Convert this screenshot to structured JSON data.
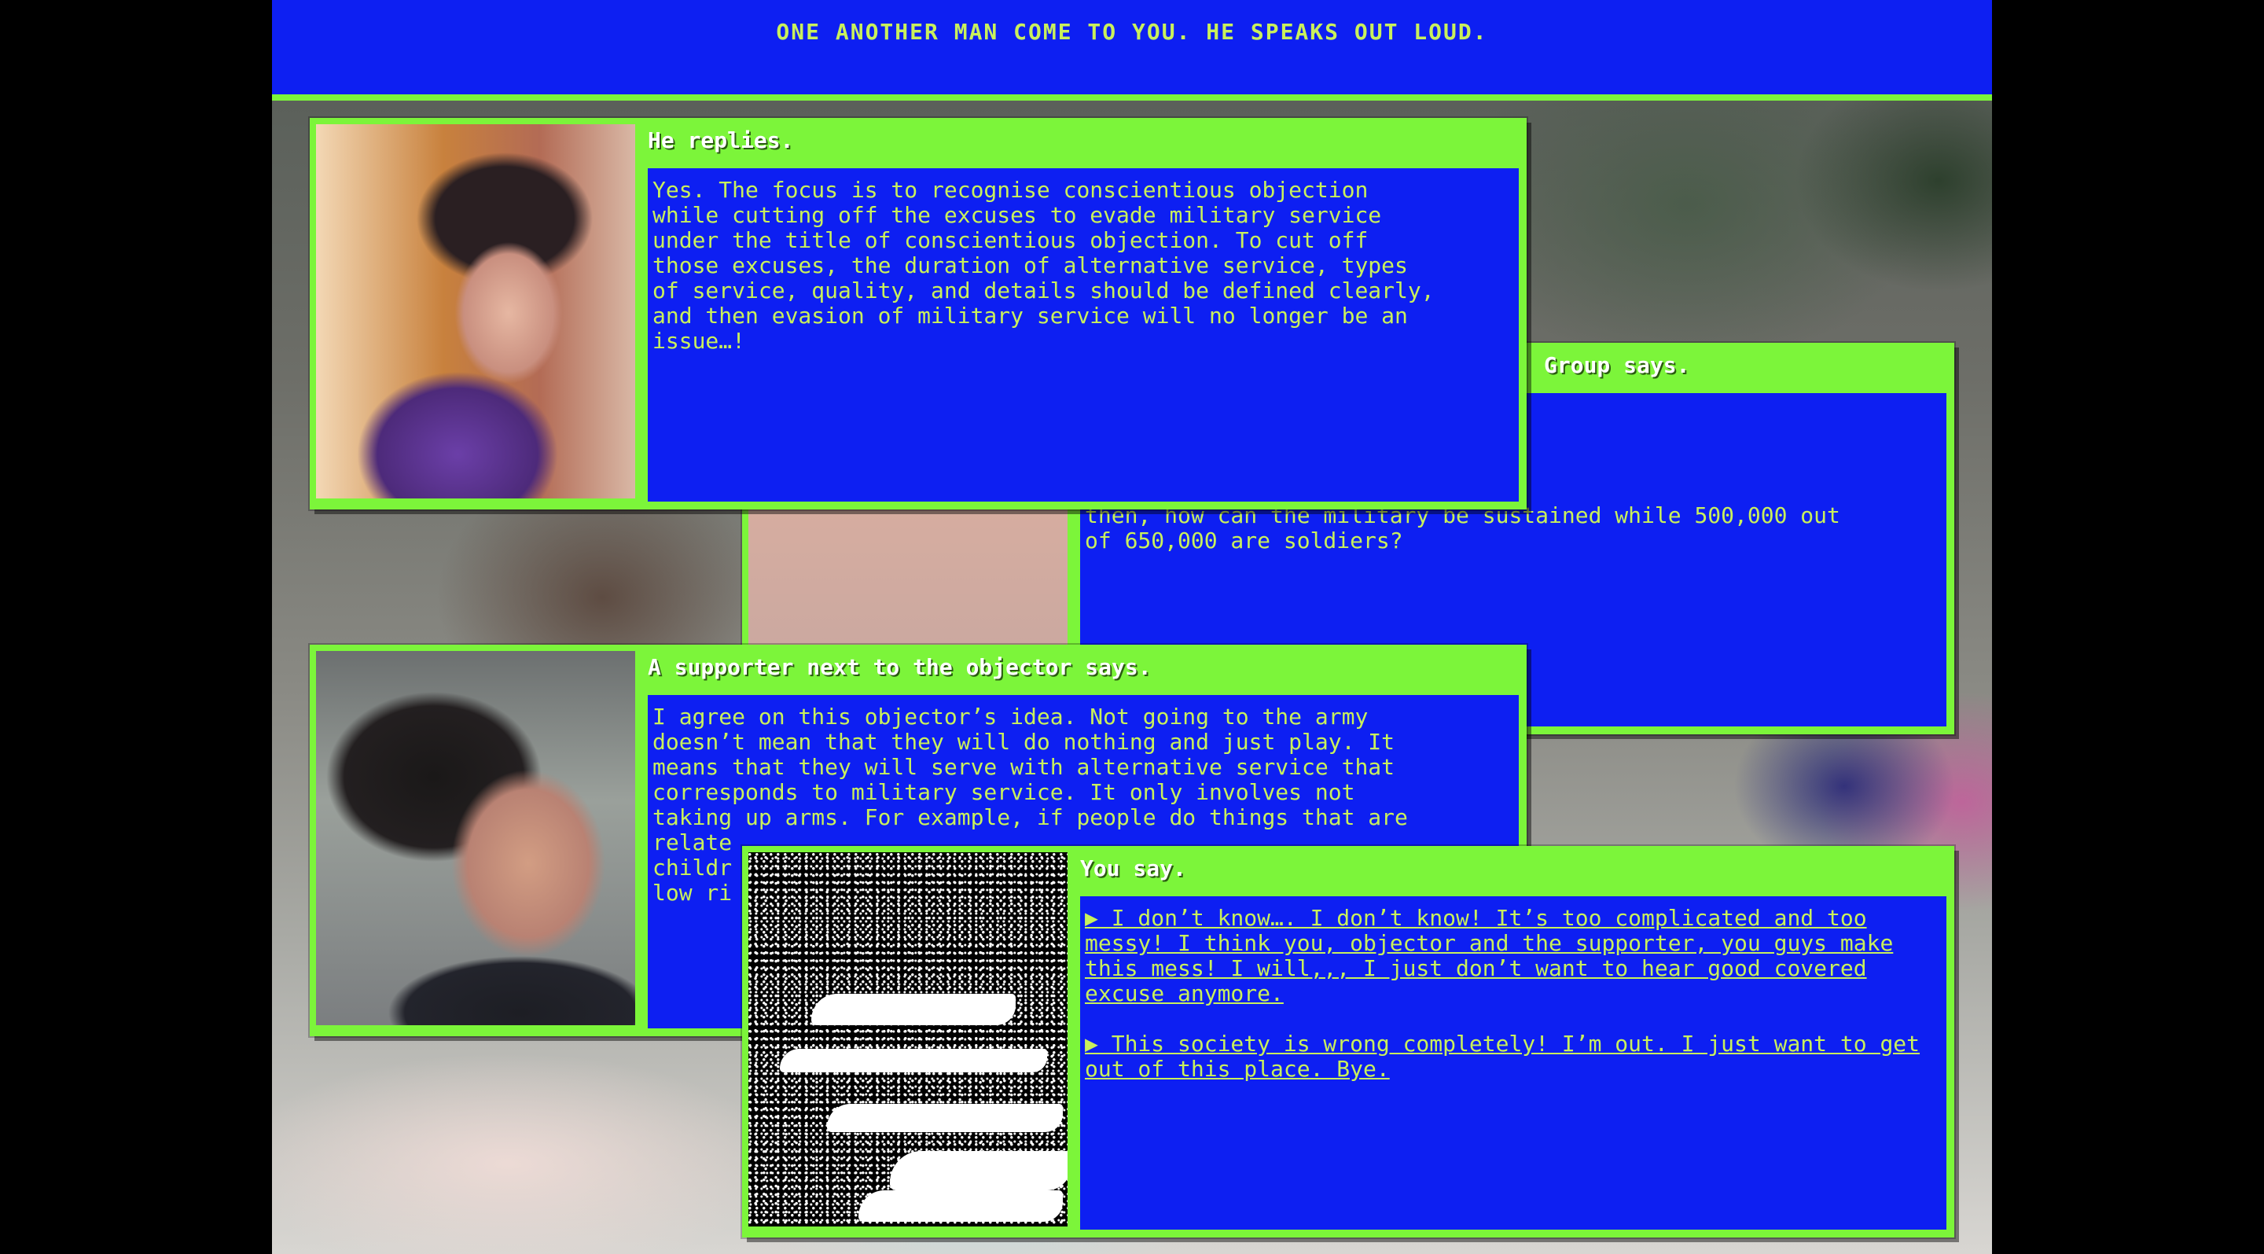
{
  "narration": "ONE ANOTHER MAN COME TO YOU. HE SPEAKS OUT LOUD.",
  "panels": {
    "group": {
      "speaker": "Group says.",
      "text": "ing. Here is Korea, not\nry to be realistic. If\ne service system instead of\none will end up leaving. So\nthen, how can the military be sustained while 500,000 out\nof 650,000 are soldiers?"
    },
    "reply": {
      "speaker": "He replies.",
      "text": "Yes. The focus is to recognise conscientious objection\nwhile cutting off the excuses to evade military service\nunder the title of conscientious objection. To cut off\nthose excuses, the duration of alternative service, types\nof service, quality, and details should be defined clearly,\nand then evasion of military service will no longer be an\nissue…!"
    },
    "supporter": {
      "speaker": "A supporter next to the objector says.",
      "text": "I agree on this objector’s idea. Not going to the army\ndoesn’t mean that they will do nothing and just play. It\nmeans that they will serve with alternative service that\ncorresponds to military service. It only involves not\ntaking up arms. For example, if people do things that are\nrelate\nchildr\nlow ri"
    },
    "you": {
      "speaker": "You say.",
      "choices": [
        "▶ I don’t know…. I don’t know! It’s too complicated and too messy! I think you, objector and the supporter, you guys make this mess! I will,,, I just don’t want to hear good covered excuse anymore.",
        "▶ This society is wrong completely! I’m out. I just want to get out of this place. Bye."
      ]
    }
  },
  "colors": {
    "accent_green": "#7cf53a",
    "dialog_blue": "#0d1ff2",
    "text_yellow_green": "#c9f05c"
  }
}
